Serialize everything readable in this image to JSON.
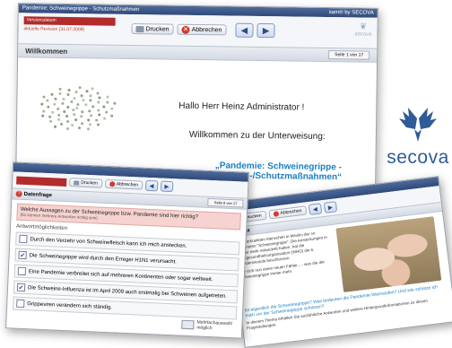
{
  "main": {
    "window_title": "Pandemie: Schweinegrippe - Schutzmaßnahmen",
    "brand": "sam® by SECOVA",
    "version_label": "Versionsdatum",
    "version_value": "aktuelle Revision (31.07.2009)",
    "print_label": "Drucken",
    "cancel_label": "Abbrechen",
    "page_title": "Willkommen",
    "page_indicator": "Seite 1 von 17",
    "greeting": "Hallo Herr Heinz Administrator !",
    "welcome": "Willkommen zu der Unterweisung:",
    "course_title_line1": "„Pandemie: Schweinegrippe -",
    "course_title_line2": "Hygiene-/Schutzmaßnahmen“",
    "small_logo": "secova"
  },
  "logo": {
    "text": "secova",
    "color": "#2f5b99"
  },
  "quiz": {
    "print_label": "Drucken",
    "cancel_label": "Abbrechen",
    "page_title": "Datenfrage",
    "page_indicator": "Seite 8 von 17",
    "question": "Welche Aussagen zu der Schweinegrippe bzw. Pandemie sind hier richtig?",
    "question_hint": "(Es können mehrere Antworten richtig sein)",
    "answers_header": "Antwortmöglichkeiten",
    "answers": [
      {
        "text": "Durch den Verzehr von Schweinefleisch kann ich mich anstecken.",
        "checked": false
      },
      {
        "text": "Die Schweinegrippe wird durch den Erreger H1N1 verursacht.",
        "checked": true
      },
      {
        "text": "Eine Pandemie verbreitet sich auf mehreren Kontinenten oder sogar weltweit.",
        "checked": false
      },
      {
        "text": "Die Schweine-Influenza ist im April 2009 auch erstmalig bei Schweinen aufgetreten.",
        "checked": true
      },
      {
        "text": "Grippeviren verändern sich ständig.",
        "checked": false
      }
    ],
    "multi_label": "Mehrfachauswahl möglich"
  },
  "info": {
    "print_label": "Drucken",
    "cancel_label": "Abbrechen",
    "heading": "Einheit",
    "para1": "2009 erkrankten Menschen in Mexiko der so genannten \"Schweinegrippe\". Die Ansteckungen in immer mehr entwickelt haben, hat die Weltgesundheitsorganisation (WHO) die 6. Pandemiestufe beschlossen.",
    "para2": "Sie sich nun einen neuen Fähler... - was die der Schweinegrippe immer mehr",
    "question_link": "Ist eigentlich die Schweinegrippe? Was bedeuten die Pandemie-Warnstufen? Und wie schütze ich mich vor der Schweinegrippe schützen?",
    "para3": "In diesem Thema erhalten Sie ausführliche Antworten und weitere Hintergrundinformationen zu diesen Fragestellungen."
  }
}
